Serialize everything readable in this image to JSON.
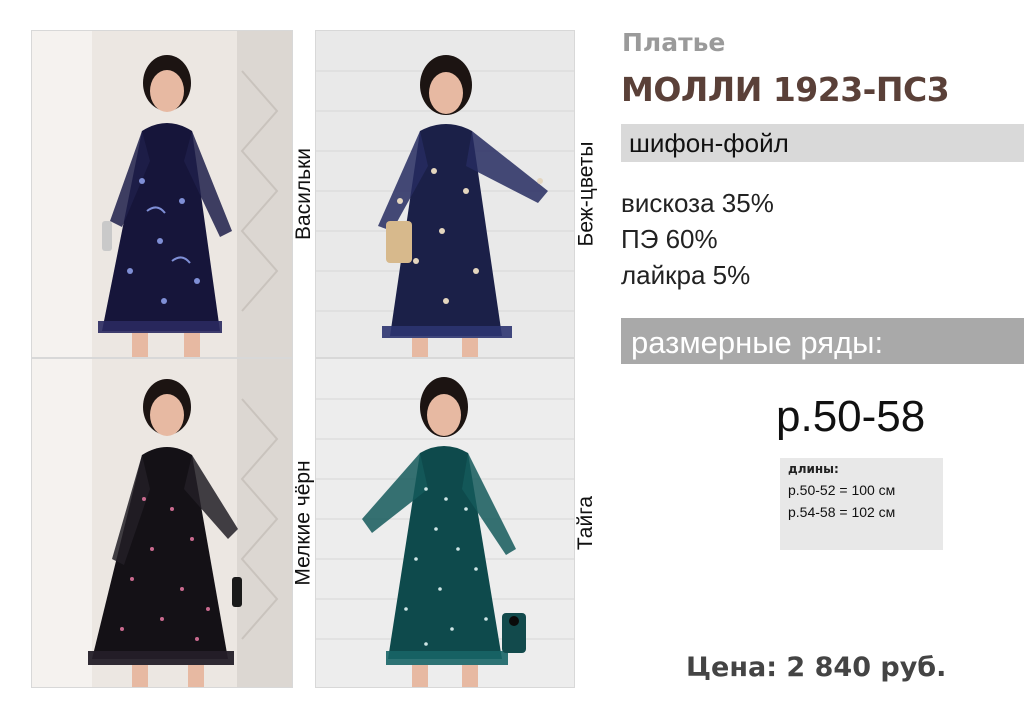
{
  "header": {
    "subtitle": "Платье",
    "title": "МОЛЛИ 1923-ПС3"
  },
  "fabric": "шифон-фойл",
  "composition": [
    "вискоза 35%",
    "ПЭ 60%",
    "лайкра 5%"
  ],
  "sizes": {
    "label": "размерные ряды:",
    "range": "р.50-58"
  },
  "lengths": {
    "title": "длины:",
    "rows": [
      "р.50-52 = 100 см",
      "р.54-58 = 102 см"
    ]
  },
  "price": "Цена: 2 840 руб.",
  "colors": [
    {
      "label": "Васильки",
      "dress": "#16153a",
      "print": "#7f8fd6",
      "bg": "#ece7e2"
    },
    {
      "label": "Беж-цветы",
      "dress": "#1b2048",
      "print": "#e4d6bf",
      "bg": "#e9e9e9"
    },
    {
      "label": "Мелкие чёрн",
      "dress": "#141116",
      "print": "#c86a8e",
      "bg": "#ece7e2"
    },
    {
      "label": "Тайга",
      "dress": "#0e4a4c",
      "print": "#cfe6e6",
      "bg": "#ededed"
    }
  ],
  "theme": {
    "title_color": "#5a4038",
    "band_light": "#d9d9d9",
    "band_dark": "#a9a9a9"
  }
}
